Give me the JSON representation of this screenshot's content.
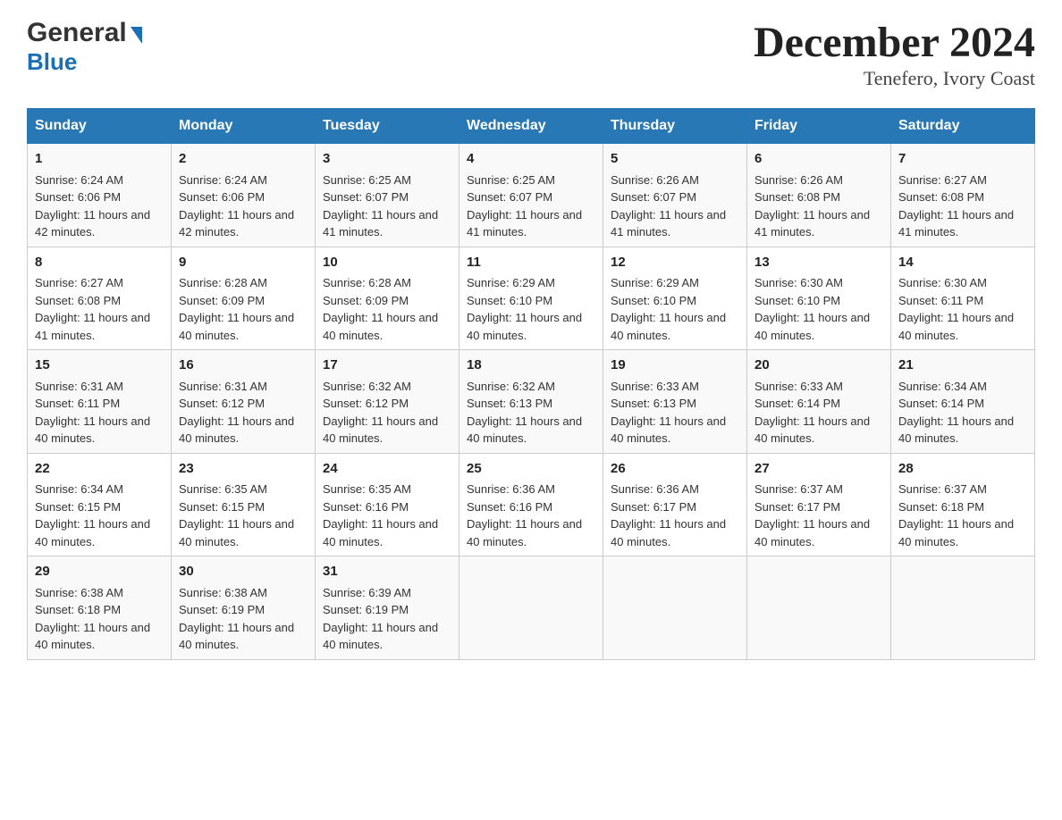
{
  "header": {
    "logo_line1": "General",
    "logo_line2": "Blue",
    "title": "December 2024",
    "subtitle": "Tenefero, Ivory Coast"
  },
  "columns": [
    "Sunday",
    "Monday",
    "Tuesday",
    "Wednesday",
    "Thursday",
    "Friday",
    "Saturday"
  ],
  "weeks": [
    [
      {
        "day": "1",
        "sunrise": "6:24 AM",
        "sunset": "6:06 PM",
        "daylight": "11 hours and 42 minutes."
      },
      {
        "day": "2",
        "sunrise": "6:24 AM",
        "sunset": "6:06 PM",
        "daylight": "11 hours and 42 minutes."
      },
      {
        "day": "3",
        "sunrise": "6:25 AM",
        "sunset": "6:07 PM",
        "daylight": "11 hours and 41 minutes."
      },
      {
        "day": "4",
        "sunrise": "6:25 AM",
        "sunset": "6:07 PM",
        "daylight": "11 hours and 41 minutes."
      },
      {
        "day": "5",
        "sunrise": "6:26 AM",
        "sunset": "6:07 PM",
        "daylight": "11 hours and 41 minutes."
      },
      {
        "day": "6",
        "sunrise": "6:26 AM",
        "sunset": "6:08 PM",
        "daylight": "11 hours and 41 minutes."
      },
      {
        "day": "7",
        "sunrise": "6:27 AM",
        "sunset": "6:08 PM",
        "daylight": "11 hours and 41 minutes."
      }
    ],
    [
      {
        "day": "8",
        "sunrise": "6:27 AM",
        "sunset": "6:08 PM",
        "daylight": "11 hours and 41 minutes."
      },
      {
        "day": "9",
        "sunrise": "6:28 AM",
        "sunset": "6:09 PM",
        "daylight": "11 hours and 40 minutes."
      },
      {
        "day": "10",
        "sunrise": "6:28 AM",
        "sunset": "6:09 PM",
        "daylight": "11 hours and 40 minutes."
      },
      {
        "day": "11",
        "sunrise": "6:29 AM",
        "sunset": "6:10 PM",
        "daylight": "11 hours and 40 minutes."
      },
      {
        "day": "12",
        "sunrise": "6:29 AM",
        "sunset": "6:10 PM",
        "daylight": "11 hours and 40 minutes."
      },
      {
        "day": "13",
        "sunrise": "6:30 AM",
        "sunset": "6:10 PM",
        "daylight": "11 hours and 40 minutes."
      },
      {
        "day": "14",
        "sunrise": "6:30 AM",
        "sunset": "6:11 PM",
        "daylight": "11 hours and 40 minutes."
      }
    ],
    [
      {
        "day": "15",
        "sunrise": "6:31 AM",
        "sunset": "6:11 PM",
        "daylight": "11 hours and 40 minutes."
      },
      {
        "day": "16",
        "sunrise": "6:31 AM",
        "sunset": "6:12 PM",
        "daylight": "11 hours and 40 minutes."
      },
      {
        "day": "17",
        "sunrise": "6:32 AM",
        "sunset": "6:12 PM",
        "daylight": "11 hours and 40 minutes."
      },
      {
        "day": "18",
        "sunrise": "6:32 AM",
        "sunset": "6:13 PM",
        "daylight": "11 hours and 40 minutes."
      },
      {
        "day": "19",
        "sunrise": "6:33 AM",
        "sunset": "6:13 PM",
        "daylight": "11 hours and 40 minutes."
      },
      {
        "day": "20",
        "sunrise": "6:33 AM",
        "sunset": "6:14 PM",
        "daylight": "11 hours and 40 minutes."
      },
      {
        "day": "21",
        "sunrise": "6:34 AM",
        "sunset": "6:14 PM",
        "daylight": "11 hours and 40 minutes."
      }
    ],
    [
      {
        "day": "22",
        "sunrise": "6:34 AM",
        "sunset": "6:15 PM",
        "daylight": "11 hours and 40 minutes."
      },
      {
        "day": "23",
        "sunrise": "6:35 AM",
        "sunset": "6:15 PM",
        "daylight": "11 hours and 40 minutes."
      },
      {
        "day": "24",
        "sunrise": "6:35 AM",
        "sunset": "6:16 PM",
        "daylight": "11 hours and 40 minutes."
      },
      {
        "day": "25",
        "sunrise": "6:36 AM",
        "sunset": "6:16 PM",
        "daylight": "11 hours and 40 minutes."
      },
      {
        "day": "26",
        "sunrise": "6:36 AM",
        "sunset": "6:17 PM",
        "daylight": "11 hours and 40 minutes."
      },
      {
        "day": "27",
        "sunrise": "6:37 AM",
        "sunset": "6:17 PM",
        "daylight": "11 hours and 40 minutes."
      },
      {
        "day": "28",
        "sunrise": "6:37 AM",
        "sunset": "6:18 PM",
        "daylight": "11 hours and 40 minutes."
      }
    ],
    [
      {
        "day": "29",
        "sunrise": "6:38 AM",
        "sunset": "6:18 PM",
        "daylight": "11 hours and 40 minutes."
      },
      {
        "day": "30",
        "sunrise": "6:38 AM",
        "sunset": "6:19 PM",
        "daylight": "11 hours and 40 minutes."
      },
      {
        "day": "31",
        "sunrise": "6:39 AM",
        "sunset": "6:19 PM",
        "daylight": "11 hours and 40 minutes."
      },
      null,
      null,
      null,
      null
    ]
  ]
}
